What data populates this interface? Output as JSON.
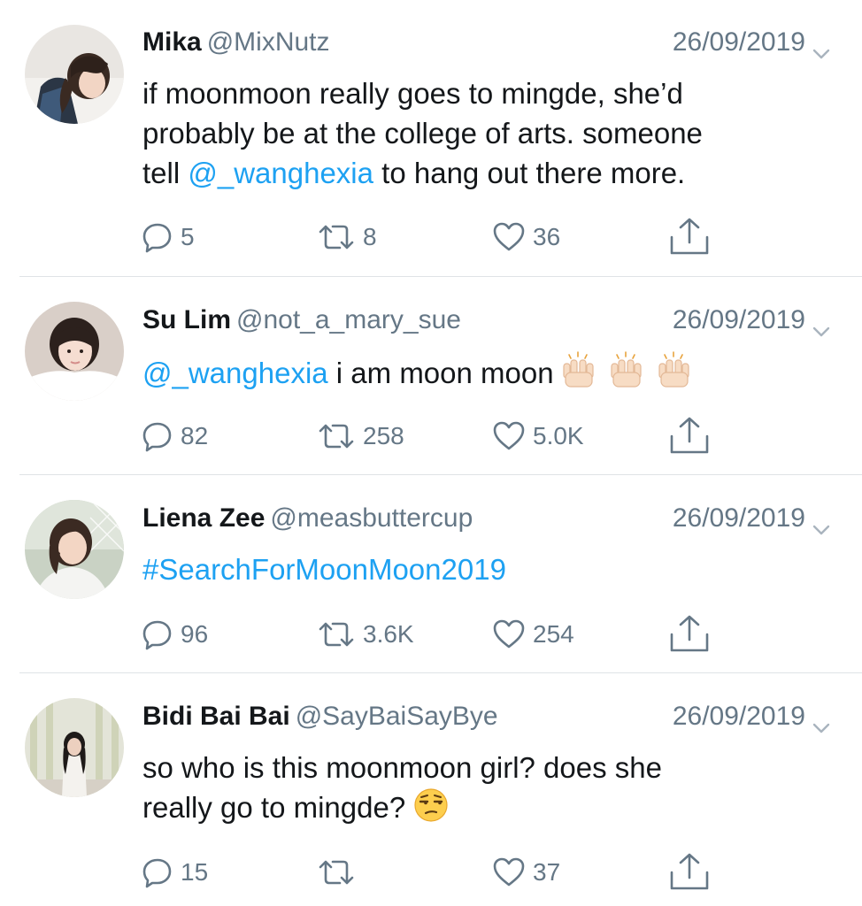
{
  "colors": {
    "text": "#14171a",
    "secondary": "#657786",
    "link": "#1da1f2",
    "divider": "#dfe3e6"
  },
  "tweets": [
    {
      "name": "Mika",
      "handle": "@MixNutz",
      "date": "26/09/2019",
      "text_lines": [
        "if moonmoon really goes to mingde, she’d",
        "probably be at the college of arts. someone"
      ],
      "text_before_mention": "tell ",
      "mention": "@_wanghexia",
      "text_after_mention": " to hang out there more.",
      "replies": "5",
      "retweets": "8",
      "likes": "36"
    },
    {
      "name": "Su Lim",
      "handle": "@not_a_mary_sue",
      "date": "26/09/2019",
      "mention": "@_wanghexia",
      "text": " i am moon moon ",
      "emoji": "raising-hands-emoji",
      "replies": "82",
      "retweets": "258",
      "likes": "5.0K"
    },
    {
      "name": "Liena Zee",
      "handle": "@measbuttercup",
      "date": "26/09/2019",
      "hashtag": "#SearchForMoonMoon2019",
      "replies": "96",
      "retweets": "3.6K",
      "likes": "254"
    },
    {
      "name": "Bidi Bai Bai",
      "handle": "@SayBaiSayBye",
      "date": "26/09/2019",
      "text_lines": [
        "so who is this moonmoon girl? does she",
        "really go to mingde? "
      ],
      "emoji": "unamused-face-emoji",
      "replies": "15",
      "retweets": "",
      "likes": "37"
    }
  ]
}
